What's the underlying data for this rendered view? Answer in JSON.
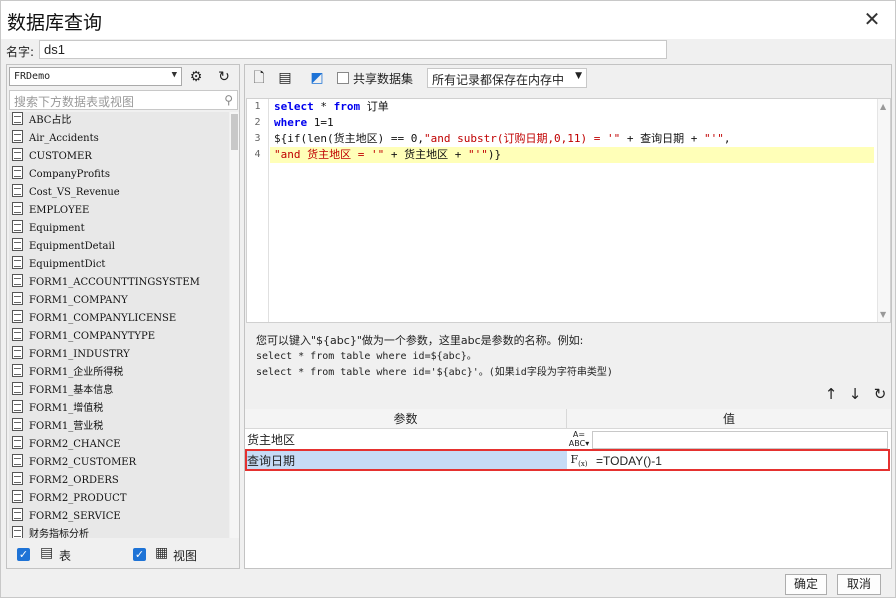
{
  "window": {
    "title": "数据库查询"
  },
  "name_field": {
    "label": "名字:",
    "value": "ds1"
  },
  "left": {
    "connection": "FRDemo",
    "search_placeholder": "搜索下方数据表或视图",
    "tables": [
      "ABC占比",
      "Air_Accidents",
      "CUSTOMER",
      "CompanyProfits",
      "Cost_VS_Revenue",
      "EMPLOYEE",
      "Equipment",
      "EquipmentDetail",
      "EquipmentDict",
      "FORM1_ACCOUNTTINGSYSTEM",
      "FORM1_COMPANY",
      "FORM1_COMPANYLICENSE",
      "FORM1_COMPANYTYPE",
      "FORM1_INDUSTRY",
      "FORM1_企业所得税",
      "FORM1_基本信息",
      "FORM1_增值税",
      "FORM1_营业税",
      "FORM2_CHANCE",
      "FORM2_CUSTOMER",
      "FORM2_ORDERS",
      "FORM2_PRODUCT",
      "FORM2_SERVICE",
      "财务指标分析"
    ],
    "filter_table_label": "表",
    "filter_view_label": "视图"
  },
  "right": {
    "share_label": "共享数据集",
    "mode_select": "所有记录都保存在内存中",
    "code_lines": [
      "1",
      "2",
      "3",
      "4"
    ],
    "hint": {
      "line1": "您可以键入\"${abc}\"做为一个参数，这里abc是参数的名称。例如:",
      "line2": "select * from table where id=${abc}。",
      "line3": "select * from table where id='${abc}'。(如果id字段为字符串类型)"
    },
    "params": {
      "col_name": "参数",
      "col_value": "值",
      "rows": [
        {
          "name": "货主地区",
          "type_icon": "abc-type-icon",
          "value": ""
        },
        {
          "name": "查询日期",
          "type_icon": "formula-icon",
          "value": "=TODAY()-1"
        }
      ]
    }
  },
  "footer": {
    "ok": "确定",
    "cancel": "取消"
  },
  "colors": {
    "keyword": "#0000ee",
    "string": "#c00000",
    "highlight": "#ffffb8",
    "selection": "#c6dbf5",
    "red_box": "#e5312f",
    "checkbox": "#1e73d6"
  }
}
